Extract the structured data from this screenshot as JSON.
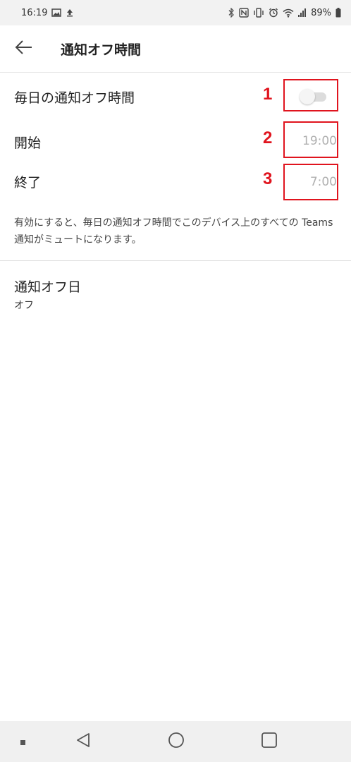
{
  "status_bar": {
    "time": "16:19",
    "battery": "89%"
  },
  "header": {
    "title": "通知オフ時間"
  },
  "settings": {
    "daily_label": "毎日の通知オフ時間",
    "daily_enabled": false,
    "start_label": "開始",
    "start_value": "19:00",
    "end_label": "終了",
    "end_value": "7:00",
    "description": "有効にすると、毎日の通知オフ時間でこのデバイス上のすべての Teams 通知がミュートになります。"
  },
  "annotations": [
    "1",
    "2",
    "3"
  ],
  "dnd_days": {
    "title": "通知オフ日",
    "value": "オフ"
  },
  "colors": {
    "annotation": "#e0141e"
  }
}
